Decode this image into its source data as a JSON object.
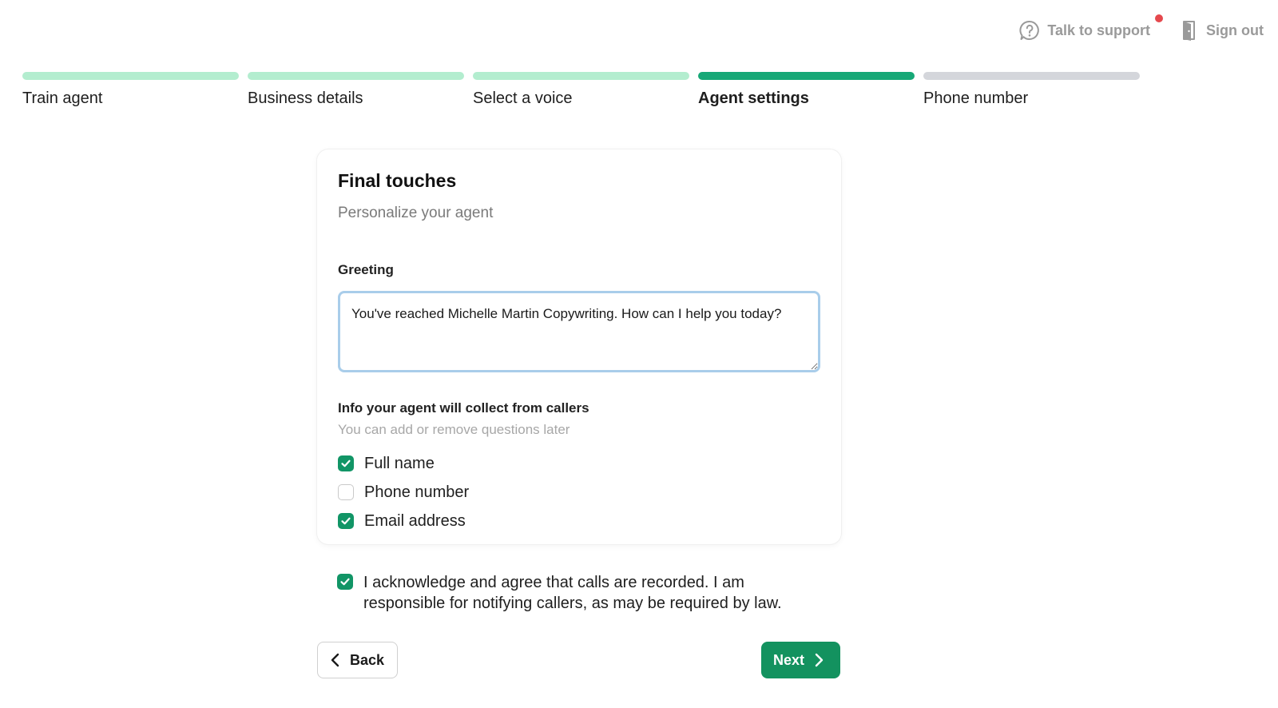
{
  "header": {
    "support_label": "Talk to support",
    "signout_label": "Sign out",
    "notification_color": "#e5484d"
  },
  "steps": [
    {
      "label": "Train agent",
      "status": "complete"
    },
    {
      "label": "Business details",
      "status": "complete"
    },
    {
      "label": "Select a voice",
      "status": "complete"
    },
    {
      "label": "Agent settings",
      "status": "active"
    },
    {
      "label": "Phone number",
      "status": "pending"
    }
  ],
  "card": {
    "title": "Final touches",
    "subtitle": "Personalize your agent",
    "greeting_label": "Greeting",
    "greeting_value": "You've reached Michelle Martin Copywriting. How can I help you today?",
    "collect_title": "Info your agent will collect from callers",
    "collect_subtitle": "You can add or remove questions later",
    "options": [
      {
        "label": "Full name",
        "checked": true
      },
      {
        "label": "Phone number",
        "checked": false
      },
      {
        "label": "Email address",
        "checked": true
      }
    ]
  },
  "consent": {
    "text": "I acknowledge and agree that calls are recorded. I am responsible for notifying callers, as may be required by law.",
    "checked": true
  },
  "footer": {
    "back_label": "Back",
    "next_label": "Next"
  },
  "colors": {
    "accent": "#13925f",
    "step_complete": "#b3edcf",
    "step_active": "#17a877",
    "step_pending": "#d4d6db"
  }
}
